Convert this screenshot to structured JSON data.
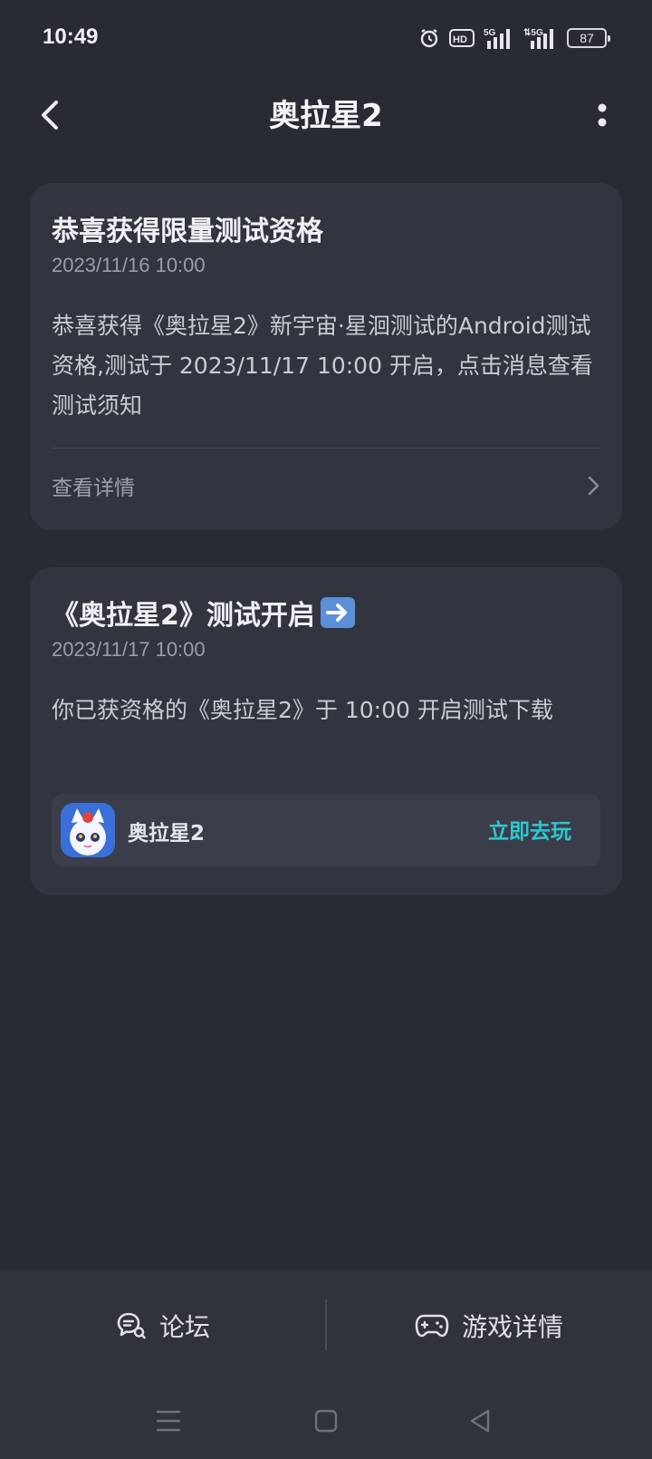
{
  "status_bar": {
    "time": "10:49",
    "battery": "87",
    "icons": [
      "alarm-icon",
      "hd-icon",
      "5g-signal-icon",
      "5g-signal-icon",
      "battery-icon"
    ]
  },
  "header": {
    "title": "奥拉星2",
    "back_icon": "chevron-left-icon",
    "more_icon": "more-vertical-icon"
  },
  "cards": [
    {
      "title": "恭喜获得限量测试资格",
      "date": "2023/11/16 10:00",
      "body": "恭喜获得《奥拉星2》新宇宙·星洄测试的Android测试资格,测试于 2023/11/17 10:00 开启，点击消息查看测试须知",
      "link_label": "查看详情"
    },
    {
      "title": "《奥拉星2》测试开启",
      "date": "2023/11/17 10:00",
      "body": "你已获资格的《奥拉星2》于 10:00 开启测试下载",
      "game_name": "奥拉星2",
      "play_label": "立即去玩"
    }
  ],
  "bottom_tabs": [
    {
      "label": "论坛",
      "icon": "forum-chat-icon"
    },
    {
      "label": "游戏详情",
      "icon": "gamepad-icon"
    }
  ],
  "colors": {
    "background": "#292b34",
    "card": "#32353f",
    "accent": "#2fc7cf"
  }
}
